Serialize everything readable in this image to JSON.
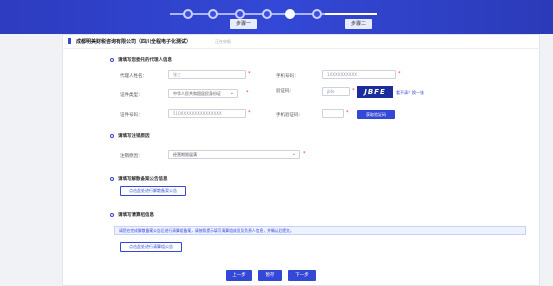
{
  "steps": {
    "step1_label": "步骤一",
    "step2_label": "步骤二"
  },
  "company": {
    "name": "成都明美财税咨询有限公司（四川全程电子化测试）",
    "sub": "正在申报"
  },
  "section1": {
    "title": "请填写您委托的代理人信息",
    "agent_name_label": "代理人姓名：",
    "agent_name_value": "张三",
    "phone_label": "手机号码：",
    "phone_value": "1XXXXXXXXXX",
    "id_type_label": "证件类型：",
    "id_type_value": "中华人民共和国居民身份证",
    "captcha_label": "验证码：",
    "captcha_value": "jbfe",
    "captcha_image_text": "JBFE",
    "captcha_refresh": "看不清？换一张",
    "id_no_label": "证件号码：",
    "id_no_value": "510XXXXXXXXXXXXXXX",
    "sms_label": "手机验证码：",
    "sms_button": "获取验证码"
  },
  "section2": {
    "title": "请填写注销原因",
    "reason_label": "注销原因：",
    "reason_value": "经营期限届满"
  },
  "section3": {
    "title": "请填写解散备案公告信息",
    "button": "点击此处进行解散备案公告"
  },
  "section4": {
    "title": "请填写清算组信息",
    "note": "请您在完成解散备案公告后进行清算组备案，请按照提示填写清算组成员及负责人信息，并确认后提交。",
    "button": "点击此处进行清算组公告"
  },
  "nav": {
    "prev": "上一步",
    "save": "暂存",
    "next": "下一步"
  }
}
